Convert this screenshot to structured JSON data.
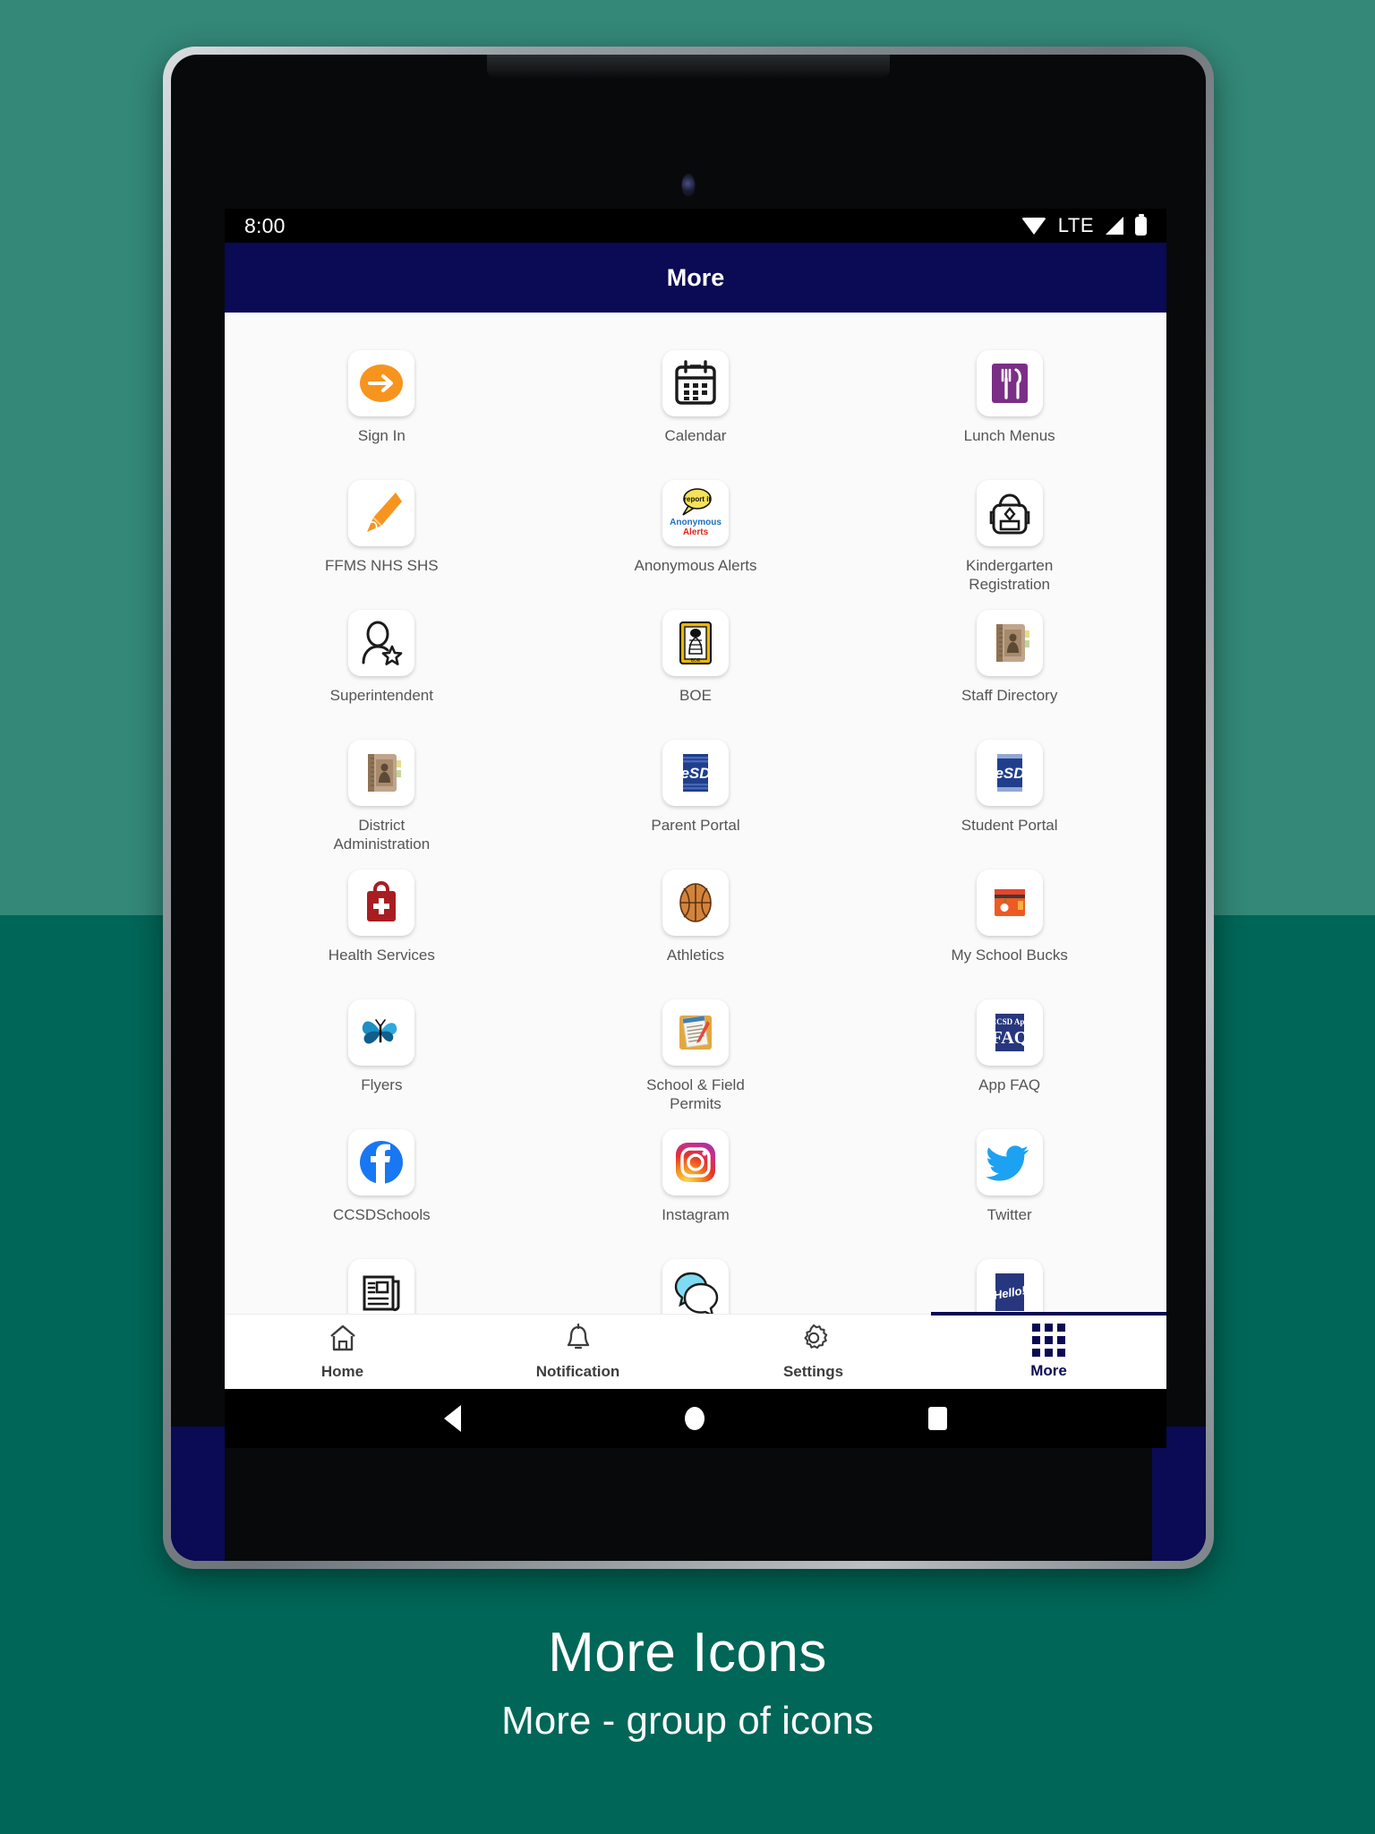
{
  "device": {
    "status_bar": {
      "time": "8:00",
      "network_label": "LTE",
      "icons": [
        "wifi-icon",
        "signal-icon",
        "battery-icon"
      ]
    },
    "android_nav": [
      "back-button",
      "home-button",
      "recent-apps-button"
    ]
  },
  "app": {
    "header": {
      "title": "More"
    },
    "grid": [
      {
        "label": "Sign In",
        "icon": "sign-in-icon"
      },
      {
        "label": "Calendar",
        "icon": "calendar-icon"
      },
      {
        "label": "Lunch Menus",
        "icon": "utensils-icon"
      },
      {
        "label": "FFMS NHS SHS",
        "icon": "megaphone-icon"
      },
      {
        "label": "Anonymous Alerts",
        "icon": "anonymous-alerts-icon"
      },
      {
        "label": "Kindergarten Registration",
        "icon": "backpack-icon"
      },
      {
        "label": "Superintendent",
        "icon": "person-star-icon"
      },
      {
        "label": "BOE",
        "icon": "board-seal-icon"
      },
      {
        "label": "Staff Directory",
        "icon": "address-book-icon"
      },
      {
        "label": "District Administration",
        "icon": "address-book-icon"
      },
      {
        "label": "Parent Portal",
        "icon": "esd-icon"
      },
      {
        "label": "Student Portal",
        "icon": "esd-icon"
      },
      {
        "label": "Health Services",
        "icon": "medical-bag-icon"
      },
      {
        "label": "Athletics",
        "icon": "basketball-icon"
      },
      {
        "label": "My School Bucks",
        "icon": "payment-card-icon"
      },
      {
        "label": "Flyers",
        "icon": "butterfly-icon"
      },
      {
        "label": "School & Field Permits",
        "icon": "clipboard-icon"
      },
      {
        "label": "App FAQ",
        "icon": "faq-icon"
      },
      {
        "label": "CCSDSchools",
        "icon": "facebook-icon"
      },
      {
        "label": "Instagram",
        "icon": "instagram-icon"
      },
      {
        "label": "Twitter",
        "icon": "twitter-icon"
      },
      {
        "label": "",
        "icon": "news-icon"
      },
      {
        "label": "",
        "icon": "chat-bubbles-icon"
      },
      {
        "label": "",
        "icon": "hello-icon"
      }
    ],
    "tabs": [
      {
        "label": "Home",
        "icon": "home-icon",
        "active": false
      },
      {
        "label": "Notification",
        "icon": "bell-icon",
        "active": false
      },
      {
        "label": "Settings",
        "icon": "gear-icon",
        "active": false
      },
      {
        "label": "More",
        "icon": "grid-dots-icon",
        "active": true
      }
    ]
  },
  "caption": {
    "title": "More Icons",
    "subtitle": "More - group of icons"
  },
  "colors": {
    "background_top": "#338878",
    "background_bottom": "#006657",
    "app_navy": "#0a0a55",
    "accent_orange": "#F7941E"
  }
}
